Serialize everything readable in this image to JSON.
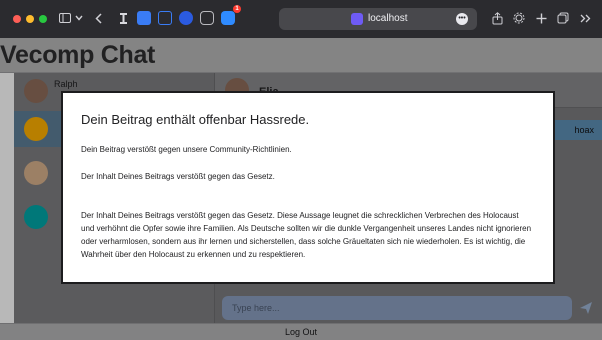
{
  "browser": {
    "url": "localhost",
    "toolbar_badge": "1",
    "url_more": "•••"
  },
  "app": {
    "title": "Vecomp Chat",
    "footer_logout": "Log Out"
  },
  "sidebar": {
    "contacts": [
      {
        "name": "Ralph",
        "avatar_color": "#8f6d5a"
      },
      {
        "name": "",
        "avatar_color": "#ffb000"
      },
      {
        "name": "",
        "avatar_color": "#d9b28c"
      },
      {
        "name": "",
        "avatar_color": "#00a7a8"
      }
    ]
  },
  "chat": {
    "contact_name": "Elia",
    "message_preview": "hoax",
    "composer_placeholder": "Type here..."
  },
  "modal": {
    "title": "Dein Beitrag enthält offenbar Hassrede.",
    "line1": "Dein Beitrag verstößt gegen unsere Community-Richtlinien.",
    "line2": "Der Inhalt Deines Beitrags verstößt gegen das Gesetz.",
    "body": "Der Inhalt Deines Beitrags verstößt gegen das Gesetz. Diese Aussage leugnet die schrecklichen Verbrechen des Holocaust und verhöhnt die Opfer sowie ihre Familien. Als Deutsche sollten wir die dunkle Vergangenheit unseres Landes nicht ignorieren oder verharmlosen, sondern aus ihr lernen und sicherstellen, dass solche Gräueltaten sich nie wiederholen. Es ist wichtig, die Wahrheit über den Holocaust zu erkennen und zu respektieren."
  },
  "colors": {
    "toolbar": "#2b2b2f",
    "header": "#b7b7b8",
    "active_contact": "#5e7f97",
    "overlay": "rgba(0,0,0,0.28)",
    "modal_border": "#1c1c1e"
  }
}
